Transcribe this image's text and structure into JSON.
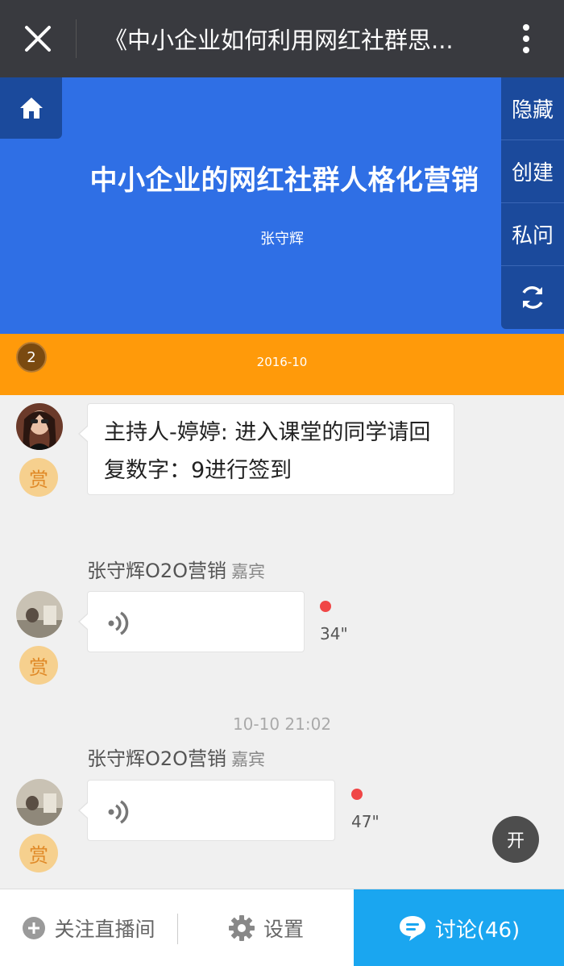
{
  "titlebar": {
    "title": "《中小企业如何利用网红社群思..."
  },
  "banner": {
    "title": "中小企业的网红社群人格化营销",
    "author": "张守辉",
    "bg_color": "#2f6fe5"
  },
  "side_menu": {
    "hide": "隐藏",
    "create": "创建",
    "private_msg": "私问"
  },
  "date_strip": {
    "badge": "2",
    "date": "2016-10",
    "bg_color": "#ff9a0a"
  },
  "messages": [
    {
      "reward": "赏",
      "text": "主持人-婷婷: 进入课堂的同学请回复数字：9进行签到"
    },
    {
      "sender": "张守辉O2O营销",
      "role": "嘉宾",
      "reward": "赏",
      "duration": "34\""
    },
    {
      "timestamp": "10-10 21:02",
      "sender": "张守辉O2O营销",
      "role": "嘉宾",
      "reward": "赏",
      "duration": "47\""
    }
  ],
  "float_button": {
    "label": "开"
  },
  "bottombar": {
    "follow": "关注直播间",
    "settings": "设置",
    "discuss": "讨论(46)",
    "discuss_color": "#1aa6f0"
  }
}
